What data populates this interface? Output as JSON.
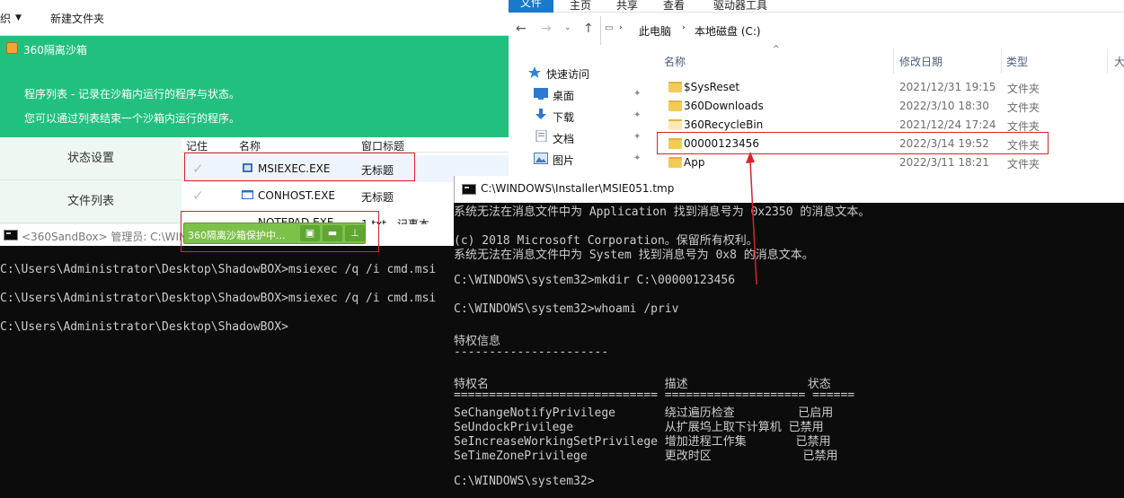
{
  "left_top_bar": {
    "item_partial": "织",
    "new_folder": "新建文件夹"
  },
  "sandbox": {
    "title": "360隔离沙箱",
    "desc1": "程序列表 - 记录在沙箱内运行的程序与状态。",
    "desc2": "您可以通过列表结束一个沙箱内运行的程序。",
    "side": [
      "状态设置",
      "文件列表"
    ],
    "columns": [
      "记住",
      "名称",
      "窗口标题"
    ],
    "rows": [
      {
        "name": "MSIEXEC.EXE",
        "title": "无标题"
      },
      {
        "name": "CONHOST.EXE",
        "title": "无标题"
      },
      {
        "name": "NOTEPAD.EXE",
        "title": "1.txt - 记事本"
      }
    ],
    "popup": "360隔离沙箱保护中...",
    "popup_icons": [
      "sandbox-icon",
      "folder-icon",
      "pin-icon"
    ]
  },
  "left_console": {
    "title": "<360SandBox> 管理员: C:\\WIN",
    "lines": [
      "C:\\Users\\Administrator\\Desktop\\ShadowBOX>msiexec /q /i cmd.msi",
      "C:\\Users\\Administrator\\Desktop\\ShadowBOX>msiexec /q /i cmd.msi",
      "C:\\Users\\Administrator\\Desktop\\ShadowBOX>"
    ]
  },
  "explorer": {
    "tabs": [
      "文件",
      "主页",
      "共享",
      "查看",
      "驱动器工具"
    ],
    "breadcrumb": [
      "此电脑",
      "本地磁盘 (C:)"
    ],
    "nav": [
      {
        "label": "快速访问",
        "icon": "star-icon"
      },
      {
        "label": "桌面",
        "icon": "desktop-icon"
      },
      {
        "label": "下载",
        "icon": "download-icon"
      },
      {
        "label": "文档",
        "icon": "document-icon"
      },
      {
        "label": "图片",
        "icon": "picture-icon"
      }
    ],
    "columns": [
      "名称",
      "修改日期",
      "类型",
      "大"
    ],
    "files": [
      {
        "name": "$SysReset",
        "date": "2021/12/31 19:15",
        "type": "文件夹"
      },
      {
        "name": "360Downloads",
        "date": "2022/3/10 18:30",
        "type": "文件夹"
      },
      {
        "name": "360RecycleBin",
        "date": "2021/12/24 17:24",
        "type": "文件夹"
      },
      {
        "name": "00000123456",
        "date": "2022/3/14 19:52",
        "type": "文件夹"
      },
      {
        "name": "App",
        "date": "2022/3/11 18:21",
        "type": "文件夹"
      }
    ]
  },
  "right_console": {
    "title": "C:\\WINDOWS\\Installer\\MSIE051.tmp",
    "lines": [
      "系统无法在消息文件中为 Application 找到消息号为 0x2350 的消息文本。",
      "",
      "(c) 2018 Microsoft Corporation。保留所有权利。",
      "系统无法在消息文件中为 System 找到消息号为 0x8 的消息文本。",
      "",
      "C:\\WINDOWS\\system32>mkdir C:\\00000123456",
      "",
      "C:\\WINDOWS\\system32>whoami /priv",
      "",
      "特权信息",
      "----------------------",
      "",
      "特权名                         描述                 状态",
      "============================= ==================== ======",
      "SeChangeNotifyPrivilege       绕过遍历检查         已启用",
      "SeUndockPrivilege             从扩展坞上取下计算机 已禁用",
      "SeIncreaseWorkingSetPrivilege 增加进程工作集       已禁用",
      "SeTimeZonePrivilege           更改时区             已禁用",
      "",
      "C:\\WINDOWS\\system32>"
    ]
  },
  "colors": {
    "sandbox_green": "#22c07e",
    "popup_green": "#7ec14a",
    "highlight_red": "#d9232b",
    "console_bg": "#0c0c0c"
  }
}
